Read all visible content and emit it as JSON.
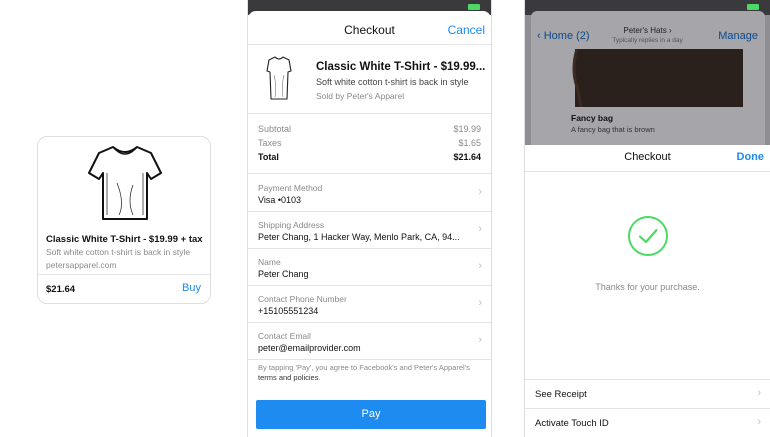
{
  "card": {
    "image_icon": "tshirt-icon",
    "title": "Classic White T-Shirt - $19.99 + tax",
    "description": "Soft white cotton t-shirt is back in style",
    "domain": "petersapparel.com",
    "price": "$21.64",
    "buy_label": "Buy"
  },
  "checkout": {
    "title": "Checkout",
    "cancel_label": "Cancel",
    "product": {
      "title": "Classic White T-Shirt - $19.99...",
      "description": "Soft white cotton t-shirt is back in style",
      "seller": "Sold by Peter's Apparel"
    },
    "totals": [
      {
        "label": "Subtotal",
        "value": "$19.99"
      },
      {
        "label": "Taxes",
        "value": "$1.65"
      },
      {
        "label": "Total",
        "value": "$21.64"
      }
    ],
    "fields": [
      {
        "label": "Payment Method",
        "value": "Visa •0103"
      },
      {
        "label": "Shipping Address",
        "value": "Peter Chang, 1 Hacker Way, Menlo Park, CA, 94..."
      },
      {
        "label": "Name",
        "value": "Peter Chang"
      },
      {
        "label": "Contact Phone Number",
        "value": "+15105551234"
      },
      {
        "label": "Contact Email",
        "value": "peter@emailprovider.com"
      }
    ],
    "terms_prefix": "By tapping 'Pay', you agree to Facebook's and Peter's Apparel's",
    "terms_link": "terms and policies",
    "terms_suffix": ".",
    "pay_label": "Pay"
  },
  "background": {
    "back_label": "Home (2)",
    "title": "Peter's Hats",
    "subtitle": "Typically replies in a day",
    "manage_label": "Manage",
    "item_title": "Fancy bag",
    "item_description": "A fancy bag that is brown"
  },
  "confirmation": {
    "title": "Checkout",
    "done_label": "Done",
    "success_icon": "check-circle-icon",
    "message": "Thanks for your purchase.",
    "rows": [
      {
        "label": "See Receipt"
      },
      {
        "label": "Activate Touch ID"
      }
    ]
  },
  "colors": {
    "accent": "#1d8bf0",
    "success": "#4cd964",
    "secondary_text": "#8a8a8e"
  }
}
